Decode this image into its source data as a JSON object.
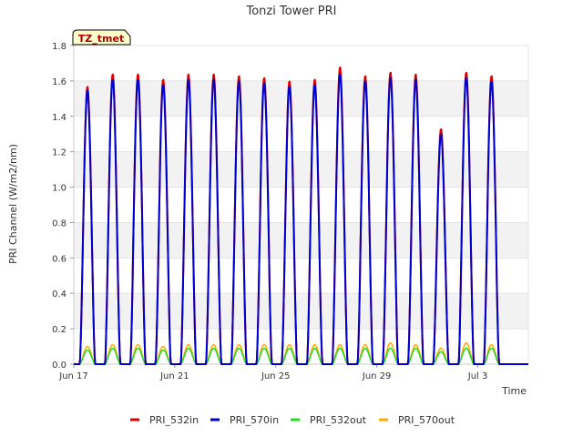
{
  "chart_data": {
    "type": "line",
    "title": "Tonzi Tower PRI",
    "xlabel": "Time",
    "ylabel": "PRI Channel (W/m2/nm)",
    "ylim": [
      0,
      1.8
    ],
    "yticks": [
      "0.0",
      "0.2",
      "0.4",
      "0.6",
      "0.8",
      "1.0",
      "1.2",
      "1.4",
      "1.6",
      "1.8"
    ],
    "xlim": [
      "2016-06-17",
      "2016-07-05"
    ],
    "xticks": [
      {
        "date": "2016-06-17",
        "label": "Jun 17"
      },
      {
        "date": "2016-06-21",
        "label": "Jun 21"
      },
      {
        "date": "2016-06-25",
        "label": "Jun 25"
      },
      {
        "date": "2016-06-29",
        "label": "Jun 29"
      },
      {
        "date": "2016-07-03",
        "label": "Jul 3"
      }
    ],
    "grid": "horizontal-bands",
    "legend_position": "bottom",
    "site_label": "TZ_tmet",
    "daily_peaks": {
      "dates": [
        "2016-06-17",
        "2016-06-18",
        "2016-06-19",
        "2016-06-20",
        "2016-06-21",
        "2016-06-22",
        "2016-06-23",
        "2016-06-24",
        "2016-06-25",
        "2016-06-26",
        "2016-06-27",
        "2016-06-28",
        "2016-06-29",
        "2016-06-30",
        "2016-07-01",
        "2016-07-02",
        "2016-07-03",
        "2016-07-04"
      ],
      "PRI_532in": [
        1.57,
        1.64,
        1.64,
        1.61,
        1.64,
        1.64,
        1.63,
        1.62,
        1.6,
        1.61,
        1.68,
        1.63,
        1.65,
        1.64,
        1.33,
        1.65,
        1.63,
        0.0
      ],
      "PRI_570in": [
        1.55,
        1.61,
        1.61,
        1.58,
        1.61,
        1.61,
        1.6,
        1.59,
        1.57,
        1.58,
        1.64,
        1.6,
        1.62,
        1.61,
        1.3,
        1.62,
        1.6,
        0.0
      ],
      "PRI_532out": [
        0.08,
        0.09,
        0.09,
        0.08,
        0.09,
        0.09,
        0.09,
        0.09,
        0.09,
        0.09,
        0.09,
        0.09,
        0.09,
        0.09,
        0.07,
        0.09,
        0.09,
        0.0
      ],
      "PRI_570out": [
        0.1,
        0.11,
        0.11,
        0.1,
        0.11,
        0.11,
        0.11,
        0.11,
        0.11,
        0.11,
        0.11,
        0.11,
        0.12,
        0.11,
        0.09,
        0.12,
        0.11,
        0.0
      ]
    },
    "series": [
      {
        "name": "PRI_532in",
        "color": "#dd0000",
        "key": "PRI_532in"
      },
      {
        "name": "PRI_570in",
        "color": "#0000cc",
        "key": "PRI_570in"
      },
      {
        "name": "PRI_532out",
        "color": "#22dd22",
        "key": "PRI_532out"
      },
      {
        "name": "PRI_570out",
        "color": "#ffaa00",
        "key": "PRI_570out"
      }
    ]
  }
}
